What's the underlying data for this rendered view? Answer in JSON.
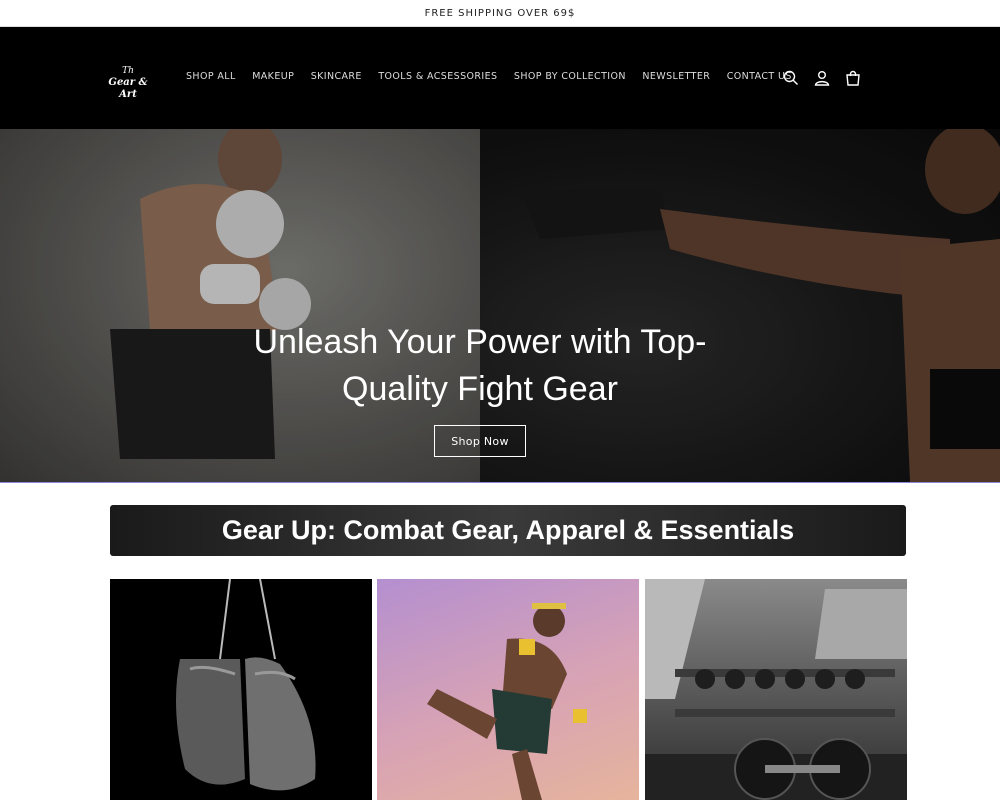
{
  "announcement": "FREE SHIPPING OVER 69$",
  "logo": {
    "line1": "Th",
    "line2": "Gear & Art"
  },
  "nav": [
    "SHOP ALL",
    "MAKEUP",
    "SKINCARE",
    "TOOLS & ACSESSORIES",
    "SHOP BY COLLECTION",
    "NEWSLETTER",
    "CONTACT US"
  ],
  "header_icons": [
    "search-icon",
    "account-icon",
    "cart-icon"
  ],
  "hero": {
    "title": "Unleash Your Power with Top-Quality Fight Gear",
    "cta": "Shop Now"
  },
  "collection_banner": "Gear Up: Combat Gear, Apparel & Essentials",
  "cards": [
    "boxing-gloves-image",
    "muay-thai-fighter-image",
    "gym-dumbbells-image"
  ]
}
